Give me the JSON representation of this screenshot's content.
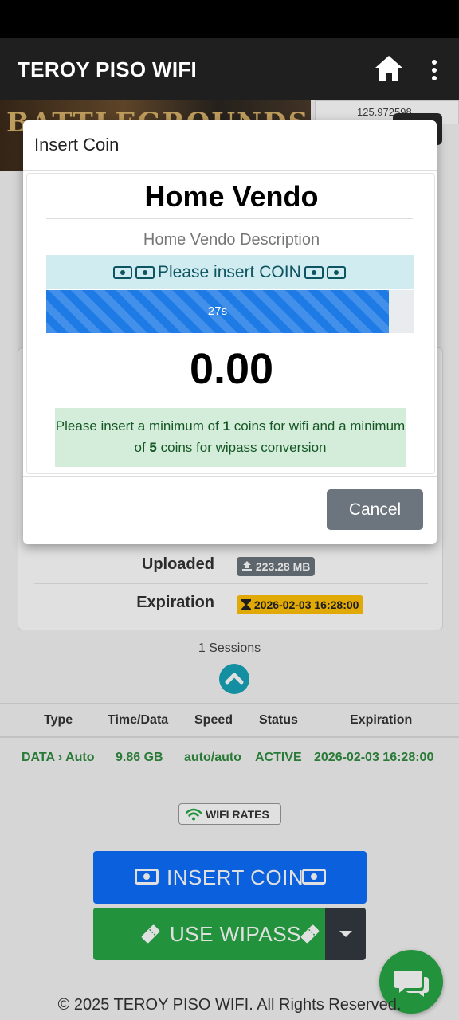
{
  "app": {
    "title": "TEROY PISO WIFI",
    "home_icon": "home-icon",
    "menu_icon": "more-vertical-icon"
  },
  "background": {
    "banner_text": "BATTLEGROUNDS",
    "coords": "125.972598",
    "info": {
      "uploaded_label": "Uploaded",
      "uploaded_value": "223.28 MB",
      "expiration_label": "Expiration",
      "expiration_value": "2026-02-03 16:28:00"
    },
    "sessions_label": "1 Sessions",
    "table": {
      "headers": [
        "Type",
        "Time/Data",
        "Speed",
        "Status",
        "Expiration"
      ],
      "rows": [
        {
          "type": "DATA › Auto",
          "time_data": "9.86 GB",
          "speed": "auto/auto",
          "status": "ACTIVE",
          "expiration": "2026-02-03 16:28:00"
        }
      ]
    },
    "wifi_rates_label": "WIFI RATES",
    "insert_coin_label": "INSERT COIN",
    "use_wipass_label": "USE WIPASS",
    "footer": "© 2025 TEROY PISO WIFI. All Rights Reserved."
  },
  "modal": {
    "title": "Insert Coin",
    "vendo_name": "Home Vendo",
    "vendo_description": "Home Vendo Description",
    "insert_message": "Please insert COIN",
    "timer_label": "27s",
    "timer_progress": 0.93,
    "amount": "0.00",
    "min_text_1": "Please insert a minimum of ",
    "min_coins_wifi": "1",
    "min_text_2": " coins for wifi and a minimum of ",
    "min_coins_wipass": "5",
    "min_text_3": " coins for wipass conversion",
    "cancel_label": "Cancel"
  },
  "colors": {
    "app_bar": "#1f1f1f",
    "primary": "#0d6efd",
    "success": "#28a745",
    "secondary": "#6c757d",
    "info_bg": "#d1ecf1",
    "success_bg": "#d4edda",
    "warning": "#ffc107"
  }
}
